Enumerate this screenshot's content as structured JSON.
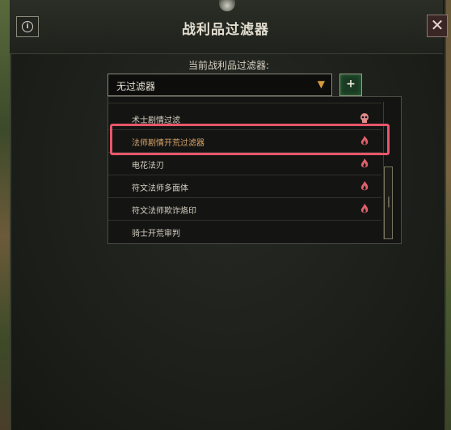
{
  "title": "战利品过滤器",
  "current_label": "当前战利品过滤器:",
  "dropdown": {
    "value": "无过滤器",
    "arrow": "▼"
  },
  "add_button": "+",
  "info_button": "i",
  "close_button": "✕",
  "list": {
    "items": [
      {
        "label": "术士剧情过滤",
        "icon": "skull-icon",
        "icon_color": "#e08a8a"
      },
      {
        "label": "法师剧情开荒过滤器",
        "icon": "flame-icon",
        "icon_color": "#e0606a",
        "highlighted": true
      },
      {
        "label": "电花法刃",
        "icon": "flame-icon",
        "icon_color": "#e0606a"
      },
      {
        "label": "符文法师多面体",
        "icon": "flame-icon",
        "icon_color": "#e0606a"
      },
      {
        "label": "符文法师欺诈烙印",
        "icon": "flame-icon",
        "icon_color": "#e0606a"
      },
      {
        "label": "骑士开荒审判",
        "icon": "",
        "icon_color": ""
      }
    ]
  },
  "colors": {
    "highlight_border": "#e8566a",
    "accent_text": "#d9a46a",
    "add_button_bg": "#1a3a24"
  }
}
